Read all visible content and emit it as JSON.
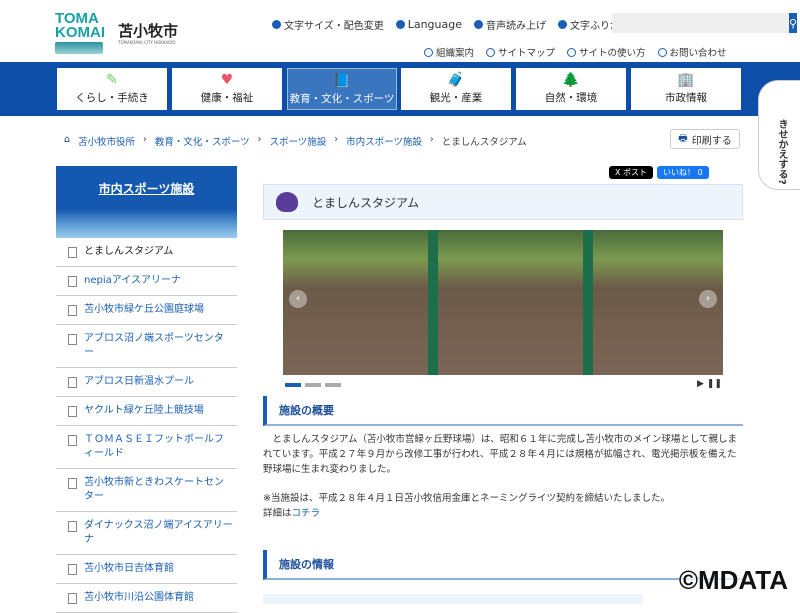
{
  "header": {
    "logo_text": "TOMAKOMAI",
    "city_name": "苫小牧市",
    "city_sub": "TOMAKOMAI CITY HOKKAIDO",
    "top_links": [
      "文字サイズ・配色変更",
      "Language",
      "音声読み上げ",
      "文字ふりがな"
    ],
    "search_placeholder": "",
    "search_icon": "search-icon",
    "sub_links": [
      "組織案内",
      "サイトマップ",
      "サイトの使い方",
      "お問い合わせ"
    ]
  },
  "nav": [
    {
      "label": "くらし・手続き",
      "icon": "✎"
    },
    {
      "label": "健康・福祉",
      "icon": "♥"
    },
    {
      "label": "教育・文化・スポーツ",
      "icon": "📘"
    },
    {
      "label": "観光・産業",
      "icon": "🧳"
    },
    {
      "label": "自然・環境",
      "icon": "🌲"
    },
    {
      "label": "市政情報",
      "icon": "🏢"
    }
  ],
  "character_label": "きせかえする?",
  "breadcrumb": [
    "苫小牧市役所",
    "教育・文化・スポーツ",
    "スポーツ施設",
    "市内スポーツ施設",
    "とましんスタジアム"
  ],
  "print_label": "印刷する",
  "sidebar": {
    "banner": "市内スポーツ施設",
    "items": [
      "とましんスタジアム",
      "nepiaアイスアリーナ",
      "苫小牧市緑ケ丘公園庭球場",
      "アブロス沼ノ端スポーツセンター",
      "アブロス日新温水プール",
      "ヤクルト緑ケ丘陸上競技場",
      "ＴＯＭＡＳＥＩフットボールフィールド",
      "苫小牧市新ときわスケートセンター",
      "ダイナックス沼ノ端アイスアリーナ",
      "苫小牧市日吉体育館",
      "苫小牧市川沿公園体育館"
    ]
  },
  "social": {
    "x": "X ポスト",
    "fb": "いいね！ 0"
  },
  "page_title": "とましんスタジアム",
  "section1": {
    "heading": "施設の概要",
    "body": "　とましんスタジアム（苫小牧市営緑ヶ丘野球場）は、昭和６１年に完成し苫小牧市のメイン球場として親しまれています。平成２７年９月から改修工事が行われ、平成２８年４月には規格が拡幅され、電光掲示板を備えた野球場に生まれ変わりました。",
    "note": "※当施設は、平成２８年４月１日苫小牧信用金庫とネーミングライツ契約を締結いたしました。",
    "detail_prefix": "詳細は",
    "detail_link": "コチラ"
  },
  "section2": {
    "heading": "施設の情報"
  },
  "watermark": "©MDATA"
}
